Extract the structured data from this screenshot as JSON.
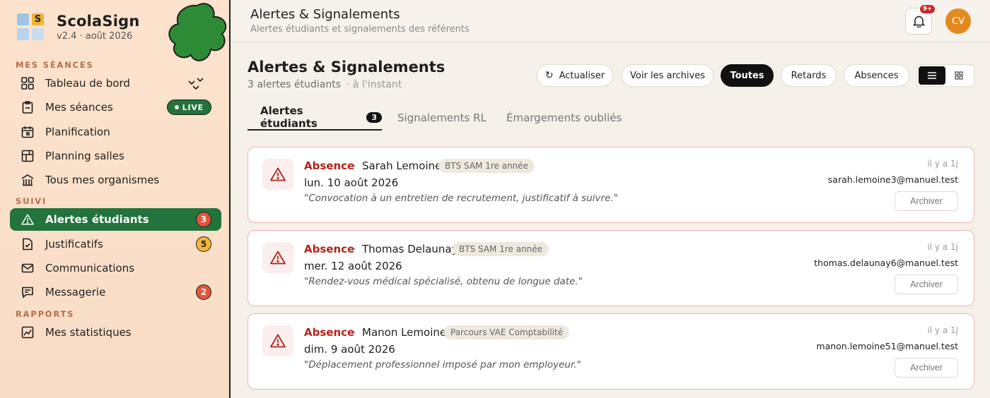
{
  "brand": {
    "name": "ScolaSign",
    "version": "v2.4 · août 2026",
    "logo_letter": "S"
  },
  "sidebar": {
    "sections": {
      "seances": "MES SÉANCES",
      "suivi": "SUIVI",
      "rapports": "RAPPORTS"
    },
    "items": [
      {
        "label": "Tableau de bord",
        "icon": "grid-icon"
      },
      {
        "label": "Mes séances",
        "icon": "clipboard-icon",
        "badge": "LIVE"
      },
      {
        "label": "Planification",
        "icon": "calendar-icon"
      },
      {
        "label": "Planning salles",
        "icon": "layout-icon"
      },
      {
        "label": "Tous mes organismes",
        "icon": "building-icon"
      },
      {
        "label": "Alertes étudiants",
        "icon": "warning-icon",
        "count": "3",
        "active": true
      },
      {
        "label": "Justificatifs",
        "icon": "document-check-icon",
        "count": "5"
      },
      {
        "label": "Communications",
        "icon": "mail-icon"
      },
      {
        "label": "Messagerie",
        "icon": "chat-icon",
        "count": "2"
      },
      {
        "label": "Mes statistiques",
        "icon": "chart-icon"
      }
    ]
  },
  "header": {
    "title": "Alertes & Signalements",
    "subtitle": "Alertes étudiants et signalements des référents",
    "notifications": "9+",
    "avatar_initials": "CV"
  },
  "main": {
    "title": "Alertes & Signalements",
    "count_text": "3 alertes étudiants",
    "updated": "· à l'instant",
    "toolbar": {
      "refresh": "Actualiser",
      "archives": "Voir les archives",
      "all": "Toutes",
      "late": "Retards",
      "absences": "Absences"
    },
    "tabs": [
      {
        "label": "Alertes étudiants",
        "count": "3"
      },
      {
        "label": "Signalements RL"
      },
      {
        "label": "Émargements oubliés"
      }
    ],
    "alerts": [
      {
        "type": "Absence",
        "name": "Sarah Lemoine",
        "program": "BTS SAM 1re année",
        "date": "lun. 10 août 2026",
        "reason": "\"Convocation à un entretien de recrutement, justificatif à suivre.\"",
        "when": "il y a 1j",
        "email": "sarah.lemoine3@manuel.test",
        "action": "Archiver"
      },
      {
        "type": "Absence",
        "name": "Thomas Delaunay",
        "program": "BTS SAM 1re année",
        "date": "mer. 12 août 2026",
        "reason": "\"Rendez-vous médical spécialisé, obtenu de longue date.\"",
        "when": "il y a 1j",
        "email": "thomas.delaunay6@manuel.test",
        "action": "Archiver"
      },
      {
        "type": "Absence",
        "name": "Manon Lemoine",
        "program": "Parcours VAE Comptabilité",
        "date": "dim. 9 août 2026",
        "reason": "\"Déplacement professionnel imposé par mon employeur.\"",
        "when": "il y a 1j",
        "email": "manon.lemoine51@manuel.test",
        "action": "Archiver"
      }
    ]
  },
  "colors": {
    "accent": "#22733c",
    "alert": "#b42318",
    "badge_red": "#e1563a",
    "badge_orange": "#f3b53a"
  }
}
